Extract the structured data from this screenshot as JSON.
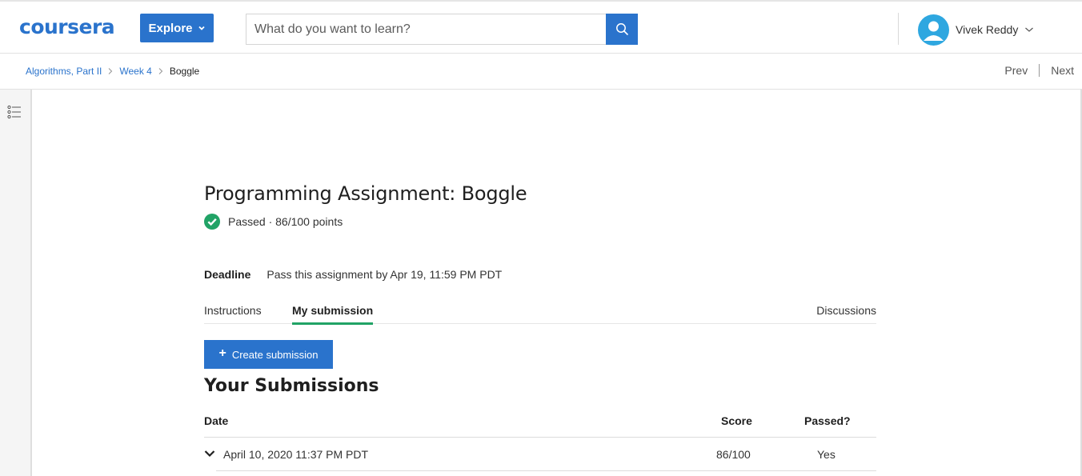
{
  "header": {
    "logo_text": "coursera",
    "explore_label": "Explore",
    "search_placeholder": "What do you want to learn?",
    "user_name": "Vivek Reddy"
  },
  "breadcrumb": {
    "items": [
      "Algorithms, Part II",
      "Week 4"
    ],
    "current": "Boggle",
    "prev_label": "Prev",
    "next_label": "Next"
  },
  "assignment": {
    "title": "Programming Assignment: Boggle",
    "status": "Passed · 86/100 points",
    "deadline_label": "Deadline",
    "deadline_text": "Pass this assignment by Apr 19, 11:59 PM PDT"
  },
  "tabs": {
    "instructions": "Instructions",
    "my_submission": "My submission",
    "discussions": "Discussions"
  },
  "create_submission_label": "Create submission",
  "submissions": {
    "heading": "Your Submissions",
    "columns": {
      "date": "Date",
      "score": "Score",
      "passed": "Passed?"
    },
    "rows": [
      {
        "date": "April 10, 2020 11:37 PM PDT",
        "score": "86/100",
        "passed": "Yes"
      }
    ]
  },
  "colors": {
    "brand_blue": "#2a73cc",
    "pass_green": "#21a366",
    "avatar_blue": "#2ea7e0"
  },
  "icons": [
    "chevron-down-icon",
    "search-icon",
    "avatar-icon",
    "chevron-right-icon",
    "outline-list-icon",
    "check-circle-icon",
    "plus-icon"
  ]
}
